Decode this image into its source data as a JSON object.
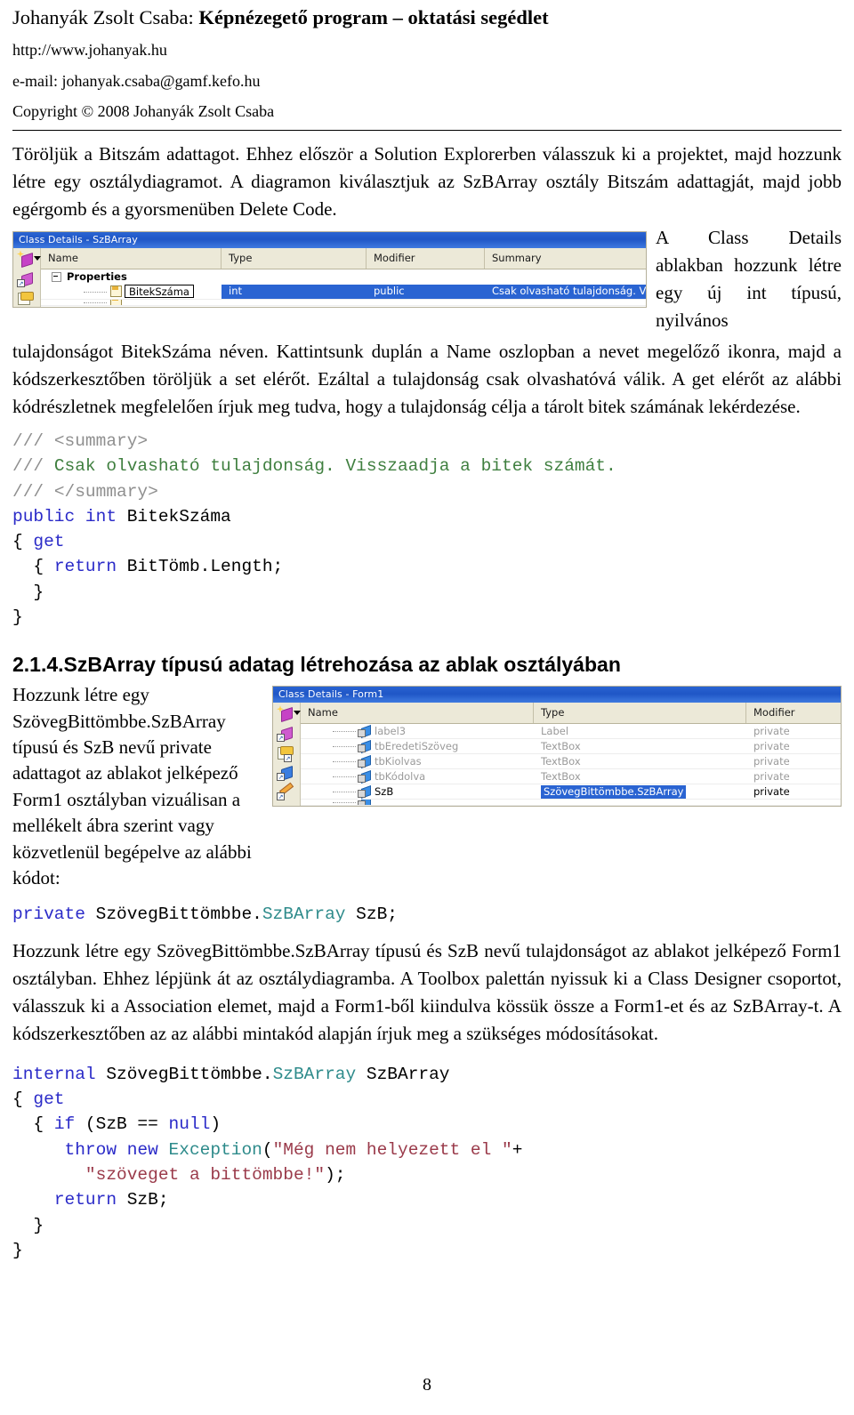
{
  "header": {
    "title_author": "Johanyák Zsolt Csaba: ",
    "title_main": "Képnézegető program – oktatási segédlet",
    "url": "http://www.johanyak.hu",
    "email": "e-mail: johanyak.csaba@gamf.kefo.hu",
    "copyright": "Copyright © 2008 Johanyák Zsolt Csaba"
  },
  "para1": "Töröljük a Bitszám adattagot. Ehhez először a Solution Explorerben válasszuk ki a projektet, majd hozzunk létre egy osztálydiagramot. A diagramon kiválasztjuk az SzBArray osztály Bitszám adattagját, majd jobb egérgomb és a gyorsmenüben Delete Code.",
  "figure1": {
    "title": "Class Details - SzBArray",
    "columns": [
      "Name",
      "Type",
      "Modifier",
      "Summary"
    ],
    "group_label": "Properties",
    "row": {
      "name": "BitekSzáma",
      "type": "int",
      "modifier": "public",
      "summary": "Csak olvasható tulajdonság. Vis..."
    },
    "toolbar_icons": [
      "new-member-icon",
      "add-property-icon",
      "add-field-icon",
      "add-method-icon"
    ]
  },
  "para2_float": "A Class Details ablakban hozzunk létre egy új int típusú, nyilvános",
  "para2": "tulajdonságot BitekSzáma néven. Kattintsunk duplán a Name oszlopban a nevet megelőző ikonra, majd a kódszerkesztőben töröljük a set elérőt. Ezáltal a tulajdonság csak olvashatóvá válik. A get elérőt az alábbi kódrészletnek megfelelően írjuk meg tudva, hogy a tulajdonság célja a tárolt bitek számának lekérdezése.",
  "code1": {
    "lines": [
      [
        {
          "t": "/// ",
          "c": "c-slash"
        },
        {
          "t": "<summary>",
          "c": "c-slash"
        }
      ],
      [
        {
          "t": "/// ",
          "c": "c-slash"
        },
        {
          "t": "Csak olvasható tulajdonság. Visszaadja a bitek számát.",
          "c": "c-com"
        }
      ],
      [
        {
          "t": "/// ",
          "c": "c-slash"
        },
        {
          "t": "</summary>",
          "c": "c-slash"
        }
      ],
      [
        {
          "t": "public",
          "c": "c-kw"
        },
        {
          "t": " ",
          "c": ""
        },
        {
          "t": "int",
          "c": "c-kw"
        },
        {
          "t": " BitekSzáma",
          "c": ""
        }
      ],
      [
        {
          "t": "{ ",
          "c": ""
        },
        {
          "t": "get",
          "c": "c-kw"
        }
      ],
      [
        {
          "t": "  { ",
          "c": ""
        },
        {
          "t": "return",
          "c": "c-kw"
        },
        {
          "t": " BitTömb.Length;",
          "c": ""
        }
      ],
      [
        {
          "t": "  }",
          "c": ""
        }
      ],
      [
        {
          "t": "}",
          "c": ""
        }
      ]
    ]
  },
  "section_heading": "2.1.4.SzBArray típusú adatag létrehozása az ablak osztályában",
  "para3_left": "Hozzunk létre egy SzövegBittömbbe.SzBArray típusú és SzB nevű private adattagot az ablakot jelképező Form1 osztályban vizuálisan a mellékelt ábra szerint vagy közvetlenül begépelve az alábbi kódot:",
  "figure2": {
    "title": "Class Details - Form1",
    "columns": [
      "Name",
      "Type",
      "Modifier"
    ],
    "rows": [
      {
        "name": "label3",
        "type": "Label",
        "modifier": "private",
        "selected": false
      },
      {
        "name": "tbEredetiSzöveg",
        "type": "TextBox",
        "modifier": "private",
        "selected": false
      },
      {
        "name": "tbKiolvas",
        "type": "TextBox",
        "modifier": "private",
        "selected": false
      },
      {
        "name": "tbKódolva",
        "type": "TextBox",
        "modifier": "private",
        "selected": false
      },
      {
        "name": "SzB",
        "type": "SzövegBittömbbe.SzBArray",
        "modifier": "private",
        "selected": true
      }
    ],
    "toolbar_icons": [
      "new-member-icon",
      "add-property-icon",
      "add-field-icon",
      "add-method-icon",
      "add-event-icon"
    ]
  },
  "code2": {
    "lines": [
      [
        {
          "t": "private",
          "c": "c-kw"
        },
        {
          "t": " SzövegBittömbbe.",
          "c": ""
        },
        {
          "t": "SzBArray",
          "c": "c-type"
        },
        {
          "t": " SzB;",
          "c": ""
        }
      ]
    ]
  },
  "para4": "Hozzunk létre egy SzövegBittömbbe.SzBArray típusú és SzB nevű tulajdonságot az ablakot jelképező Form1 osztályban. Ehhez lépjünk át az osztálydiagramba. A Toolbox palettán nyissuk ki a Class Designer csoportot, válasszuk ki a Association elemet, majd a Form1-ből kiindulva kössük össze a Form1-et és az SzBArray-t. A kódszerkesztőben az az alábbi mintakód alapján írjuk meg a szükséges módosításokat.",
  "code3": {
    "lines": [
      [
        {
          "t": "internal",
          "c": "c-kw"
        },
        {
          "t": " SzövegBittömbbe.",
          "c": ""
        },
        {
          "t": "SzBArray",
          "c": "c-type"
        },
        {
          "t": " SzBArray",
          "c": ""
        }
      ],
      [
        {
          "t": "{ ",
          "c": ""
        },
        {
          "t": "get",
          "c": "c-kw"
        }
      ],
      [
        {
          "t": "  { ",
          "c": ""
        },
        {
          "t": "if",
          "c": "c-kw"
        },
        {
          "t": " (SzB == ",
          "c": ""
        },
        {
          "t": "null",
          "c": "c-kw"
        },
        {
          "t": ")",
          "c": ""
        }
      ],
      [
        {
          "t": "     ",
          "c": ""
        },
        {
          "t": "throw new",
          "c": "c-kw"
        },
        {
          "t": " ",
          "c": ""
        },
        {
          "t": "Exception",
          "c": "c-type"
        },
        {
          "t": "(",
          "c": ""
        },
        {
          "t": "\"Még nem helyezett el \"",
          "c": "c-str"
        },
        {
          "t": "+",
          "c": ""
        }
      ],
      [
        {
          "t": "       ",
          "c": ""
        },
        {
          "t": "\"szöveget a bittömbbe!\"",
          "c": "c-str"
        },
        {
          "t": ");",
          "c": ""
        }
      ],
      [
        {
          "t": "    ",
          "c": ""
        },
        {
          "t": "return",
          "c": "c-kw"
        },
        {
          "t": " SzB;",
          "c": ""
        }
      ],
      [
        {
          "t": "  }",
          "c": ""
        }
      ],
      [
        {
          "t": "}",
          "c": ""
        }
      ]
    ]
  },
  "footer": {
    "page_number": "8"
  }
}
